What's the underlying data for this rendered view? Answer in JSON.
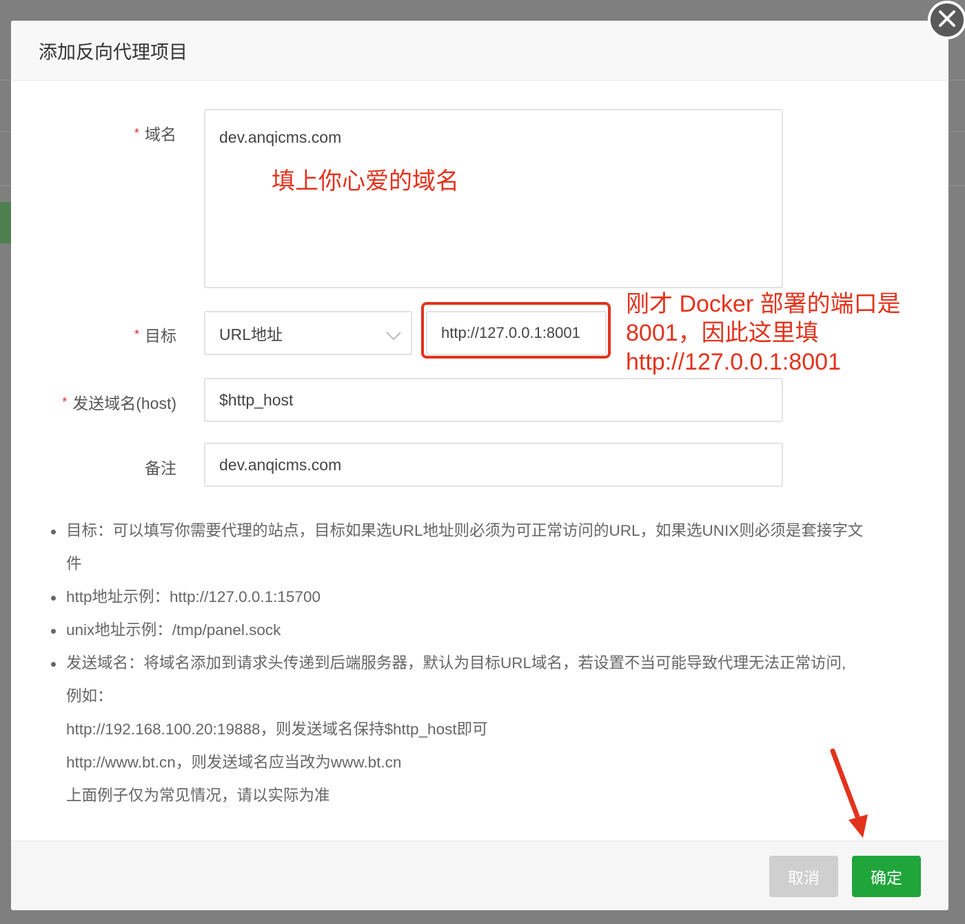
{
  "dialog": {
    "title": "添加反向代理项目"
  },
  "form": {
    "domain": {
      "label": "域名",
      "value": "dev.anqicms.com"
    },
    "target": {
      "label": "目标",
      "type_value": "URL地址",
      "url_value": "http://127.0.0.1:8001"
    },
    "send_host": {
      "label": "发送域名(host)",
      "value": "$http_host"
    },
    "remark": {
      "label": "备注",
      "value": "dev.anqicms.com"
    }
  },
  "annotations": {
    "domain_note": "填上你心爱的域名",
    "port_note_line1": "刚才 Docker 部署的端口是",
    "port_note_line2": "8001，因此这里填",
    "port_note_line3": "http://127.0.0.1:8001"
  },
  "help": {
    "item1_a": "目标：可以填写你需要代理的站点，目标如果选URL地址则必须为可正常访问的URL，如果选UNIX则必须是套接字文",
    "item1_b": "件",
    "item2": "http地址示例：http://127.0.0.1:15700",
    "item3": "unix地址示例：/tmp/panel.sock",
    "item4_a": "发送域名：将域名添加到请求头传递到后端服务器，默认为目标URL域名，若设置不当可能导致代理无法正常访问,",
    "item4_b": "例如：",
    "item4_c": "http://192.168.100.20:19888，则发送域名保持$http_host即可",
    "item4_d": "http://www.bt.cn，则发送域名应当改为www.bt.cn",
    "item4_e": "上面例子仅为常见情况，请以实际为准"
  },
  "buttons": {
    "cancel": "取消",
    "confirm": "确定"
  },
  "colors": {
    "accent_green": "#20a53a",
    "annotation_red": "#e3321c",
    "required_red": "#e02c2c"
  },
  "icons": [
    "close-icon",
    "chevron-down-icon",
    "arrow-annotation-icon"
  ]
}
